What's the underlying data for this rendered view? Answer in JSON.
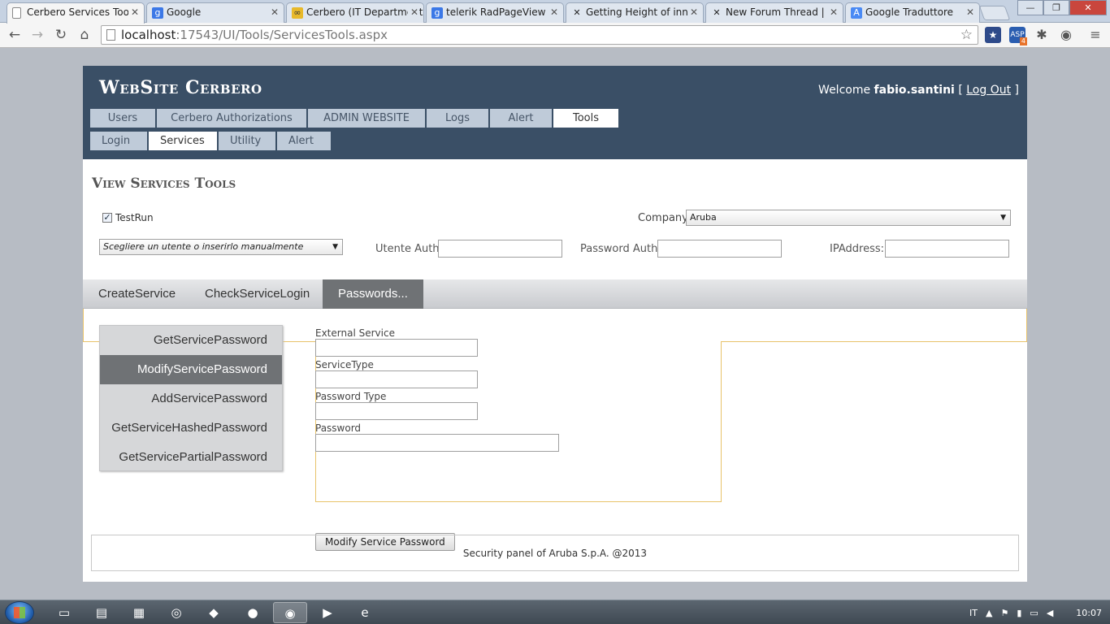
{
  "browser": {
    "tabs": [
      {
        "title": "Cerbero Services Tools",
        "active": true,
        "icon": "page-icon"
      },
      {
        "title": "Google",
        "active": false,
        "icon": "google-icon"
      },
      {
        "title": "Cerbero (IT Department)",
        "active": false,
        "icon": "infinity-icon"
      },
      {
        "title": "telerik RadPageView b",
        "active": false,
        "icon": "google-icon"
      },
      {
        "title": "Getting Height of inne",
        "active": false,
        "icon": "telerik-icon"
      },
      {
        "title": "New Forum Thread | T",
        "active": false,
        "icon": "telerik-icon"
      },
      {
        "title": "Google Traduttore",
        "active": false,
        "icon": "translate-icon"
      }
    ],
    "url_host": "localhost",
    "url_path": ":17543/UI/Tools/ServicesTools.aspx",
    "ext_badge": "4",
    "colors": {
      "accent": "#3a4f66",
      "tab_selected": "#6f7275",
      "frame_border": "#e8c36a"
    }
  },
  "header": {
    "site_title": "WebSite Cerbero",
    "welcome_prefix": "Welcome",
    "username": "fabio.santini",
    "logout_open": "[",
    "logout_label": "Log Out",
    "logout_close": "]",
    "menu_primary": [
      "Users",
      "Cerbero Authorizations",
      "ADMIN WEBSITE",
      "Logs",
      "Alert",
      "Tools"
    ],
    "menu_secondary": [
      "Login",
      "Services",
      "Utility",
      "Alert"
    ]
  },
  "content": {
    "title": "View Services Tools",
    "testrun_label": "TestRun",
    "testrun_checked_mark": "✓",
    "company_label": "Company",
    "company_value": "Aruba",
    "user_select_value": "Scegliere un utente o inserirlo manualmente",
    "utente_auth_label": "Utente Auth:",
    "password_auth_label": "Password Auth:",
    "ipaddress_label": "IPAddress:"
  },
  "tabstrip": {
    "tabs": [
      "CreateService",
      "CheckServiceLogin",
      "Passwords..."
    ]
  },
  "password_tabs": [
    "GetServicePassword",
    "ModifyServicePassword",
    "AddServicePassword",
    "GetServiceHashedPassword",
    "GetServicePartialPassword"
  ],
  "form": {
    "external_service_label": "External Service",
    "service_type_label": "ServiceType",
    "password_type_label": "Password Type",
    "password_label": "Password",
    "submit_label": "Modify Service Password"
  },
  "footer": {
    "text": "Security panel of Aruba S.p.A. @2013"
  },
  "taskbar": {
    "lang": "IT",
    "time": "10:07"
  }
}
